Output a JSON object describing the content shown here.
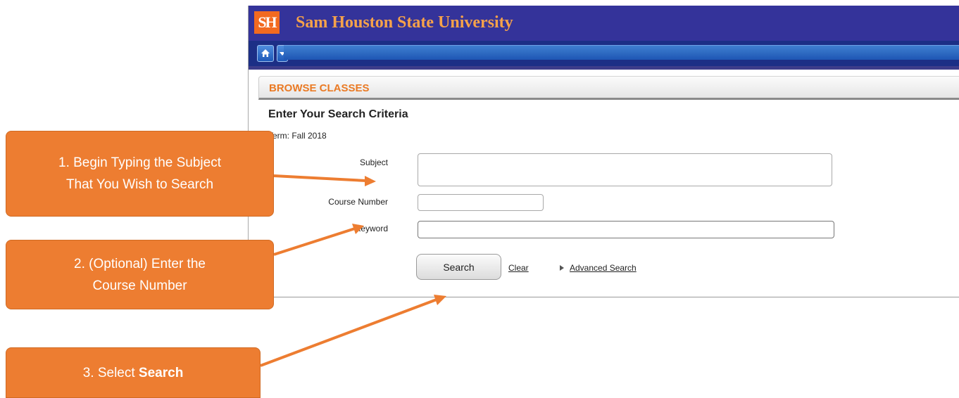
{
  "header": {
    "logo_text": "SH",
    "university_name": "Sam Houston State University"
  },
  "section": {
    "title": "BROWSE CLASSES"
  },
  "search_form": {
    "heading": "Enter Your Search Criteria",
    "term": "Term: Fall 2018",
    "subject_label": "Subject",
    "subject_value": "",
    "course_number_label": "Course Number",
    "course_number_value": "",
    "keyword_label": "Keyword",
    "keyword_value": "",
    "search_button": "Search",
    "clear_link": "Clear",
    "advanced_search_link": "Advanced Search"
  },
  "callouts": {
    "step1_line1": "1. Begin Typing the Subject",
    "step1_line2": "That You Wish to Search",
    "step2_line1": "2. (Optional) Enter the",
    "step2_line2": "Course Number",
    "step3_prefix": "3. Select ",
    "step3_bold": "Search"
  },
  "colors": {
    "header_bg": "#34339a",
    "university_name": "#f6a24a",
    "section_title": "#ea7a24",
    "callout_bg": "#ed7d31",
    "nav_bar": "#1e56b4"
  },
  "icons": {
    "home": "home-icon",
    "menu": "chevron-down-icon",
    "advanced": "triangle-right-icon"
  }
}
